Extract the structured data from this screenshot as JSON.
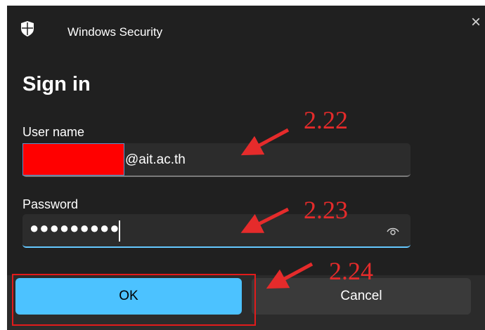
{
  "window": {
    "title": "Windows Security",
    "close_glyph": "×",
    "icon": "shield-icon"
  },
  "heading": "Sign in",
  "username": {
    "label": "User name",
    "visible_value": "@ait.ac.th",
    "redacted": true
  },
  "password": {
    "label": "Password",
    "masked_value": "●●●●●●●●●",
    "reveal_icon": "eye-icon"
  },
  "buttons": {
    "ok_label": "OK",
    "cancel_label": "Cancel"
  },
  "annotations": {
    "step_username": "2.22",
    "step_password": "2.23",
    "step_ok": "2.24"
  },
  "colors": {
    "dialog_bg": "#202020",
    "accent": "#4cc2ff",
    "annotation": "#e52b2b",
    "redaction": "#ff0000"
  }
}
